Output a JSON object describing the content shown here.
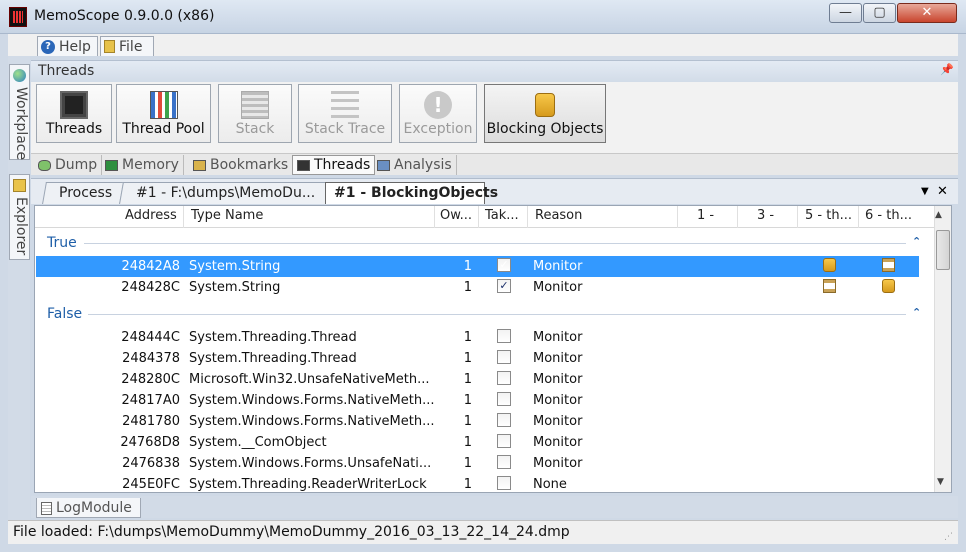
{
  "window": {
    "title": "MemoScope 0.9.0.0 (x86)",
    "min": "—",
    "max": "▢",
    "close": "✕"
  },
  "menu": {
    "help": "Help",
    "file": "File"
  },
  "side_tabs": {
    "workplace": "Workplace",
    "explorer": "Explorer"
  },
  "panel": {
    "title": "Threads",
    "pin": "📌"
  },
  "ribbon": [
    {
      "label": "Threads",
      "enabled": true
    },
    {
      "label": "Thread Pool",
      "enabled": true
    },
    {
      "label": "Stack",
      "enabled": false
    },
    {
      "label": "Stack Trace",
      "enabled": false
    },
    {
      "label": "Exception",
      "enabled": false
    },
    {
      "label": "Blocking Objects",
      "enabled": true,
      "active": true
    }
  ],
  "exception_glyph": "!",
  "module_tabs": [
    "Dump",
    "Memory",
    "Bookmarks",
    "Threads",
    "Analysis"
  ],
  "doc_tabs": {
    "process": "Process",
    "dump": "#1 - F:\\dumps\\MemoDu...",
    "active": "#1 - BlockingObjects",
    "menu": "▼",
    "close": "✕"
  },
  "columns": {
    "address": "Address",
    "type": "Type Name",
    "owner": "Ow...",
    "taken": "Tak...",
    "reason": "Reason",
    "c1": "1 -",
    "c3": "3 -",
    "c5": "5 - th...",
    "c6": "6 - th..."
  },
  "groups": {
    "true": "True",
    "false": "False",
    "collapse": "⌃"
  },
  "rows_true": [
    {
      "address": "24842A8",
      "type": "System.String",
      "owner": "1",
      "taken": "✓",
      "reason": "Monitor",
      "col5": "lock",
      "col6": "hourglass",
      "selected": true
    },
    {
      "address": "248428C",
      "type": "System.String",
      "owner": "1",
      "taken": "✓",
      "reason": "Monitor",
      "col5": "hourglass",
      "col6": "lock",
      "selected": false
    }
  ],
  "rows_false": [
    {
      "address": "248444C",
      "type": "System.Threading.Thread",
      "owner": "1",
      "taken": "",
      "reason": "Monitor"
    },
    {
      "address": "2484378",
      "type": "System.Threading.Thread",
      "owner": "1",
      "taken": "",
      "reason": "Monitor"
    },
    {
      "address": "248280C",
      "type": "Microsoft.Win32.UnsafeNativeMeth...",
      "owner": "1",
      "taken": "",
      "reason": "Monitor"
    },
    {
      "address": "24817A0",
      "type": "System.Windows.Forms.NativeMeth...",
      "owner": "1",
      "taken": "",
      "reason": "Monitor"
    },
    {
      "address": "2481780",
      "type": "System.Windows.Forms.NativeMeth...",
      "owner": "1",
      "taken": "",
      "reason": "Monitor"
    },
    {
      "address": "24768D8",
      "type": "System.__ComObject",
      "owner": "1",
      "taken": "",
      "reason": "Monitor"
    },
    {
      "address": "2476838",
      "type": "System.Windows.Forms.UnsafeNati...",
      "owner": "1",
      "taken": "",
      "reason": "Monitor"
    },
    {
      "address": "245E0FC",
      "type": "System.Threading.ReaderWriterLock",
      "owner": "1",
      "taken": "",
      "reason": "None"
    }
  ],
  "scroll": {
    "up": "▲",
    "down": "▼"
  },
  "log_tab": "LogModule",
  "status": "File loaded: F:\\dumps\\MemoDummy\\MemoDummy_2016_03_13_22_14_24.dmp",
  "grip": "⋰",
  "colors": {
    "selection": "#3399ff",
    "group_text": "#1f5fa8"
  }
}
